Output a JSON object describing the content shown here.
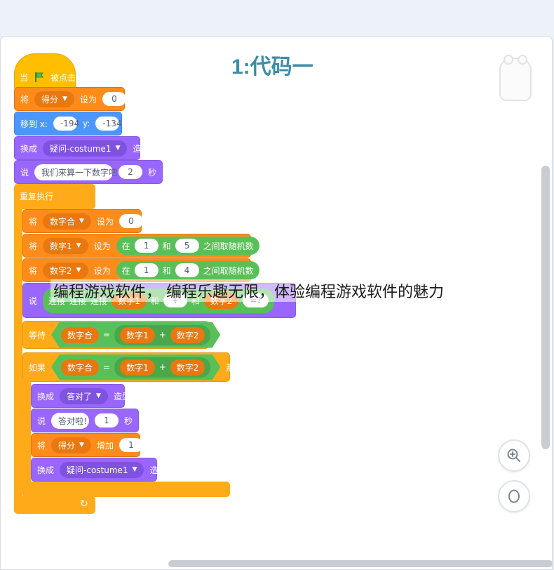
{
  "title": "1:代码一",
  "caption": "编程游戏软件， 编程乐趣无限，体验编程游戏软件的魅力",
  "colors": {
    "events": "#ffbf00",
    "variables": "#ff8c1a",
    "control": "#ffab19",
    "motion": "#4c97ff",
    "looks": "#9966ff",
    "operators": "#59c059"
  },
  "blocks": {
    "hat": {
      "word": "当",
      "flag": "flag-icon",
      "label": "被点击"
    },
    "set_score": {
      "word": "将",
      "var": "得分",
      "mid": "设为",
      "value": "0"
    },
    "goto": {
      "word": "移到 x:",
      "x": "-194",
      "ylabel": "y:",
      "y": "-134"
    },
    "switch1": {
      "word": "换成",
      "costume": "疑问-costume1",
      "tail": "造型"
    },
    "say1": {
      "word": "说",
      "text": "我们来算一下数字吧",
      "secs": "2",
      "tail": "秒"
    },
    "forever": {
      "label": "重复执行"
    },
    "set_sum": {
      "word": "将",
      "var": "数字合",
      "mid": "设为",
      "value": "0"
    },
    "set_n1": {
      "word": "将",
      "var": "数字1",
      "mid": "设为",
      "op_a": "在",
      "from": "1",
      "op_and": "和",
      "to": "5",
      "op_tail": "之间取随机数"
    },
    "set_n2": {
      "word": "将",
      "var": "数字2",
      "mid": "设为",
      "op_a": "在",
      "from": "1",
      "op_and": "和",
      "to": "4",
      "op_tail": "之间取随机数"
    },
    "say2": {
      "word": "说",
      "join1": "连接",
      "join2": "连接",
      "join3": "连接",
      "v1": "数字1",
      "plus": "+",
      "and1": "和",
      "v2": "数字2",
      "and2": "和",
      "q": "=?"
    },
    "wait": {
      "word": "等待",
      "left": "数字合",
      "eq": "=",
      "a": "数字1",
      "plus": "+",
      "b": "数字2"
    },
    "if": {
      "word": "如果",
      "left": "数字合",
      "eq": "=",
      "a": "数字1",
      "plus": "+",
      "b": "数字2",
      "then": "那么"
    },
    "switch2": {
      "word": "换成",
      "costume": "答对了",
      "tail": "造型"
    },
    "say3": {
      "word": "说",
      "text": "答对啦！",
      "secs": "1",
      "tail": "秒"
    },
    "change_score": {
      "word": "将",
      "var": "得分",
      "mid": "增加",
      "value": "1"
    },
    "switch3": {
      "word": "换成",
      "costume": "疑问-costume1",
      "tail": "造型"
    }
  },
  "icons": {
    "flag": "flag-icon",
    "loop_arrow": "loop-arrow-icon",
    "zoom_in": "zoom-in-icon",
    "zoom_reset": "zoom-reset-icon",
    "sprite": "bear-sprite-icon"
  }
}
